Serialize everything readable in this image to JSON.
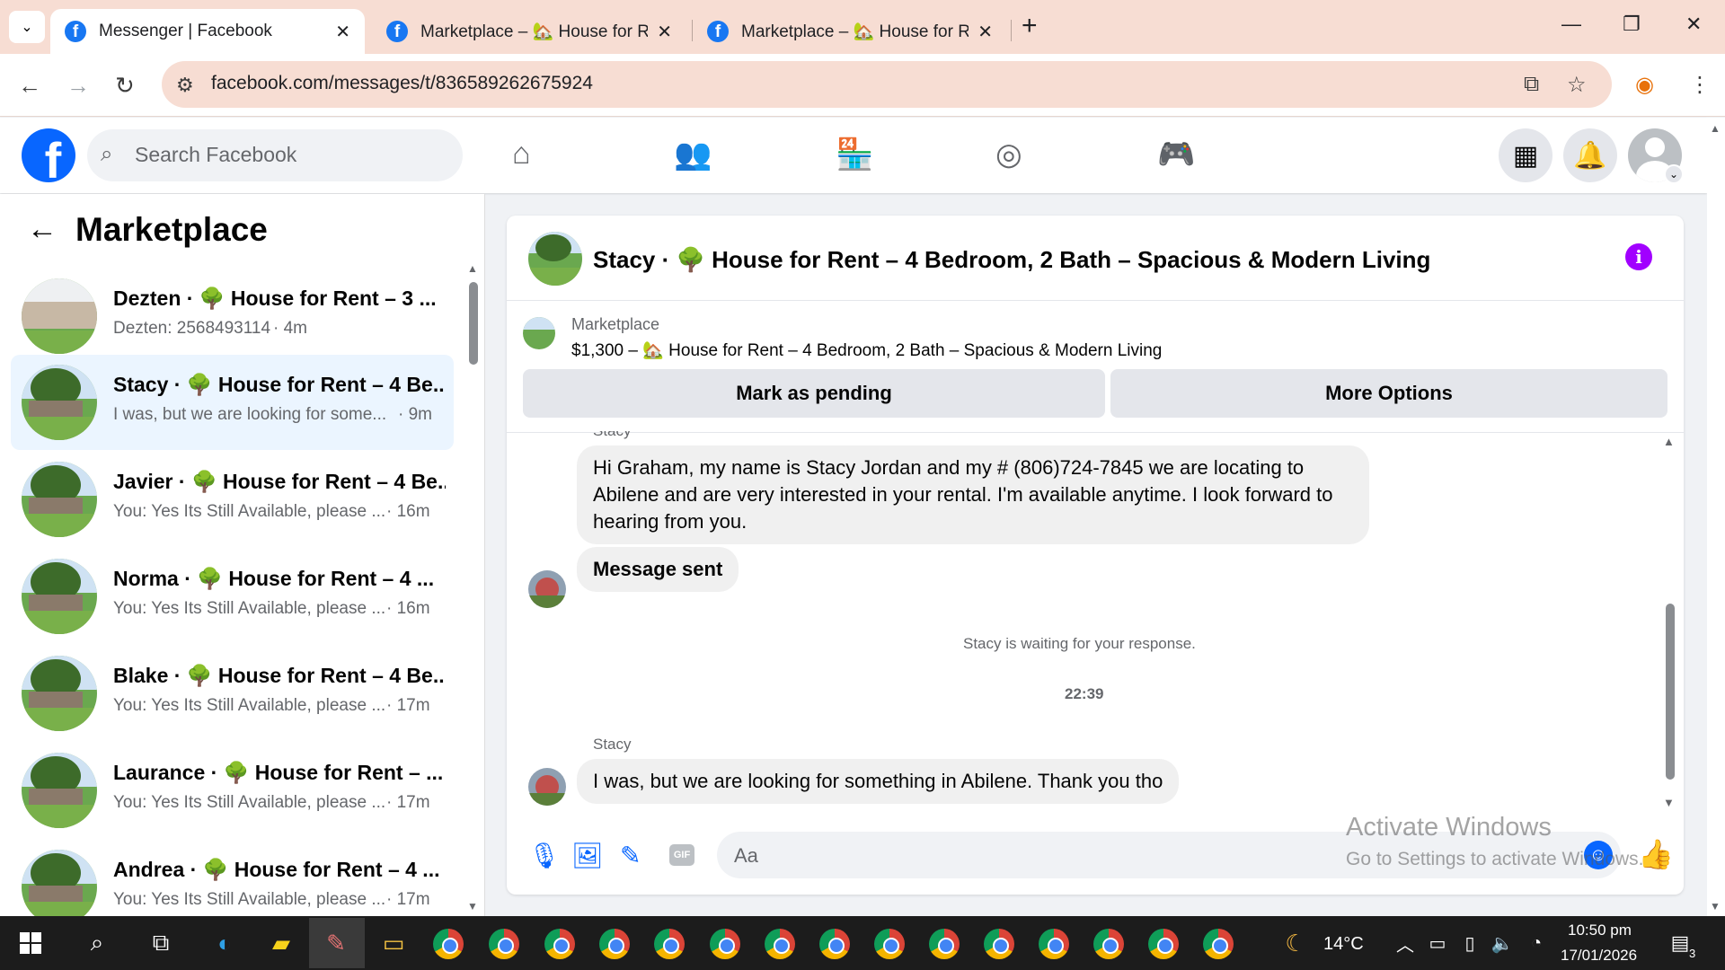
{
  "browser": {
    "tabs": [
      {
        "title": "Messenger | Facebook",
        "active": true
      },
      {
        "title": "Marketplace – 🏡 House for Re",
        "active": false
      },
      {
        "title": "Marketplace – 🏡 House for Re",
        "active": false
      }
    ],
    "url": "facebook.com/messages/t/836589262675924"
  },
  "fb_nav": {
    "logo": "f",
    "search_placeholder": "Search Facebook"
  },
  "sidebar": {
    "title": "Marketplace",
    "conversations": [
      {
        "name": "Dezten · 🌳 House for Rent – 3 ...",
        "preview": "Dezten: 2568493114",
        "time": "· 4m",
        "active": false
      },
      {
        "name": "Stacy · 🌳 House for Rent – 4 Be...",
        "preview": "I was, but we are looking for some...",
        "time": "· 9m",
        "active": true
      },
      {
        "name": "Javier · 🌳 House for Rent – 4 Be...",
        "preview": "You: Yes Its Still Available, please ...",
        "time": "· 16m",
        "active": false
      },
      {
        "name": "Norma · 🌳 House for Rent – 4 ...",
        "preview": "You: Yes Its Still Available, please ...",
        "time": "· 16m",
        "active": false
      },
      {
        "name": "Blake · 🌳 House for Rent – 4 Be...",
        "preview": "You: Yes Its Still Available, please ...",
        "time": "· 17m",
        "active": false
      },
      {
        "name": "Laurance · 🌳 House for Rent – ...",
        "preview": "You: Yes Its Still Available, please ...",
        "time": "· 17m",
        "active": false
      },
      {
        "name": "Andrea · 🌳 House for Rent – 4 ...",
        "preview": "You: Yes Its Still Available, please ...",
        "time": "· 17m",
        "active": false
      }
    ]
  },
  "chat": {
    "title": "Stacy · 🌳 House for Rent – 4 Bedroom, 2 Bath – Spacious & Modern Living",
    "listing": {
      "source": "Marketplace",
      "title": "$1,300 – 🏡 House for Rent – 4 Bedroom, 2 Bath – Spacious & Modern Living"
    },
    "buttons": {
      "pending": "Mark as pending",
      "more": "More Options"
    },
    "messages": {
      "sender_top": "Stacy",
      "msg1": "Hi Graham, my name is Stacy Jordan and my # (806)724-7845 we are locating to Abilene and are very interested in your rental. I'm available anytime. I look forward to hearing from you.",
      "msg2": "Message sent",
      "waiting": "Stacy is waiting for your response.",
      "timestamp": "22:39",
      "sender_bottom": "Stacy",
      "msg3": "I was, but we are looking for something in Abilene. Thank you tho"
    },
    "composer_placeholder": "Aa"
  },
  "watermark": {
    "line1": "Activate Windows",
    "line2": "Go to Settings to activate Windows."
  },
  "taskbar": {
    "weather": "14°C",
    "time": "10:50 pm",
    "date": "17/01/2026",
    "notifications": "3"
  }
}
